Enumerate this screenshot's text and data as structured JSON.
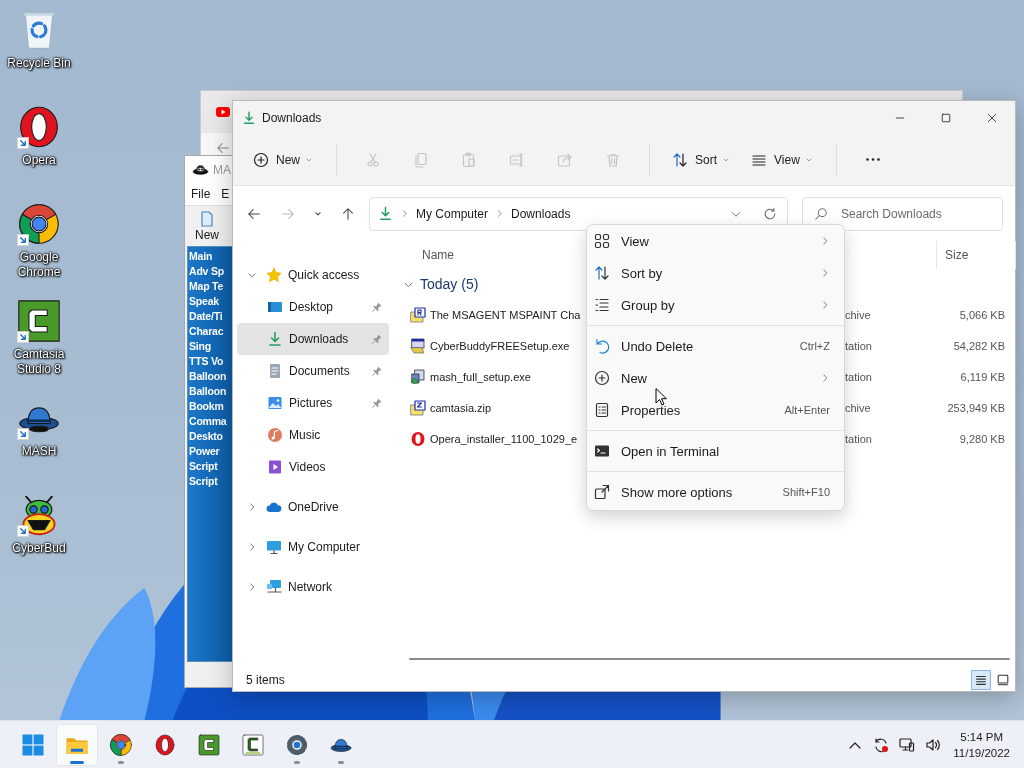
{
  "desktop_icons": [
    {
      "kind": "recycle-bin",
      "label": "Recycle Bin",
      "shortcut": false
    },
    {
      "kind": "opera",
      "label": "Opera",
      "shortcut": true
    },
    {
      "kind": "chrome",
      "label": "Google Chrome",
      "shortcut": true
    },
    {
      "kind": "camtasia",
      "label": "Camtasia Studio 8",
      "shortcut": true
    },
    {
      "kind": "mash",
      "label": "MASH",
      "shortcut": true
    },
    {
      "kind": "cyberbuddy",
      "label": "CyberBud",
      "shortcut": true
    }
  ],
  "mash_window": {
    "title": "MA",
    "menu": [
      "File",
      "E"
    ],
    "toolbar": [
      {
        "kind": "new",
        "label": "New"
      }
    ],
    "list": [
      "Main",
      "Adv Sp",
      "Map Te",
      "Speak",
      "Date/Ti",
      "Charac",
      "Sing",
      "TTS Vo",
      "Balloon",
      "Balloon",
      "Bookm",
      "Comma",
      "Deskto",
      "Power",
      "Script",
      "Script"
    ]
  },
  "explorer": {
    "title": "Downloads",
    "toolbar": [
      {
        "kind": "new",
        "label": "New",
        "dropdown": true,
        "disabled": false
      },
      {
        "kind": "separator"
      },
      {
        "kind": "cut",
        "disabled": true
      },
      {
        "kind": "copy",
        "disabled": true
      },
      {
        "kind": "paste",
        "disabled": true
      },
      {
        "kind": "rename",
        "disabled": true
      },
      {
        "kind": "share",
        "disabled": true
      },
      {
        "kind": "delete",
        "disabled": true
      },
      {
        "kind": "separator"
      },
      {
        "kind": "sort",
        "label": "Sort",
        "dropdown": true,
        "disabled": false
      },
      {
        "kind": "view",
        "label": "View",
        "dropdown": true,
        "disabled": false
      },
      {
        "kind": "separator"
      },
      {
        "kind": "more",
        "disabled": false
      }
    ],
    "navigation": [
      {
        "kind": "back",
        "disabled": false
      },
      {
        "kind": "forward",
        "disabled": true
      },
      {
        "kind": "recent",
        "disabled": false
      },
      {
        "kind": "up",
        "disabled": false
      }
    ],
    "breadcrumb": [
      "My Computer",
      "Downloads"
    ],
    "search": {
      "placeholder": "Search Downloads"
    },
    "nav_pane": [
      {
        "kind": "quick-access",
        "label": "Quick access",
        "expanded": true,
        "selected": false,
        "children": [
          {
            "kind": "desktop",
            "label": "Desktop",
            "pinned": true,
            "selected": false
          },
          {
            "kind": "downloads",
            "label": "Downloads",
            "pinned": true,
            "selected": true
          },
          {
            "kind": "documents",
            "label": "Documents",
            "pinned": true,
            "selected": false
          },
          {
            "kind": "pictures",
            "label": "Pictures",
            "pinned": true,
            "selected": false
          },
          {
            "kind": "music",
            "label": "Music",
            "pinned": false,
            "selected": false
          },
          {
            "kind": "videos",
            "label": "Videos",
            "pinned": false,
            "selected": false
          }
        ]
      },
      {
        "kind": "onedrive",
        "label": "OneDrive",
        "expanded": false,
        "selected": false
      },
      {
        "kind": "computer",
        "label": "My Computer",
        "expanded": false,
        "selected": false
      },
      {
        "kind": "network",
        "label": "Network",
        "expanded": false,
        "selected": false
      }
    ],
    "columns": {
      "name": "Name",
      "size": "Size"
    },
    "group": {
      "label": "Today (5)",
      "expanded": true
    },
    "files": [
      {
        "kind": "package",
        "name": "The MSAGENT MSPAINT Cha",
        "column_2": "chive",
        "size": "5,066 KB"
      },
      {
        "kind": "installer",
        "name": "CyberBuddyFREESetup.exe",
        "column_2": "tation",
        "size": "54,282 KB"
      },
      {
        "kind": "setup",
        "name": "mash_full_setup.exe",
        "column_2": "tation",
        "size": "6,119 KB"
      },
      {
        "kind": "archive",
        "name": "camtasia.zip",
        "column_2": "chive",
        "size": "253,949 KB"
      },
      {
        "kind": "opera",
        "name": "Opera_installer_1100_1029_e",
        "column_2": "tation",
        "size": "9,280 KB"
      }
    ],
    "status": "5 items",
    "view_modes": [
      {
        "kind": "details",
        "selected": true
      },
      {
        "kind": "tiles",
        "selected": false
      }
    ]
  },
  "context_menu": [
    {
      "kind": "view",
      "label": "View",
      "submenu": true
    },
    {
      "kind": "sort",
      "label": "Sort by",
      "submenu": true
    },
    {
      "kind": "group",
      "label": "Group by",
      "submenu": true
    },
    {
      "kind": "separator"
    },
    {
      "kind": "undo",
      "label": "Undo Delete",
      "shortcut": "Ctrl+Z",
      "submenu": false
    },
    {
      "kind": "new",
      "label": "New",
      "submenu": true
    },
    {
      "kind": "properties",
      "label": "Properties",
      "shortcut": "Alt+Enter",
      "submenu": false
    },
    {
      "kind": "separator"
    },
    {
      "kind": "terminal",
      "label": "Open in Terminal",
      "submenu": false
    },
    {
      "kind": "separator"
    },
    {
      "kind": "more-options",
      "label": "Show more options",
      "shortcut": "Shift+F10",
      "submenu": false
    }
  ],
  "taskbar": {
    "apps": [
      {
        "kind": "start",
        "running": false,
        "active": false
      },
      {
        "kind": "explorer",
        "running": true,
        "active": true
      },
      {
        "kind": "chrome",
        "running": true,
        "active": false
      },
      {
        "kind": "opera",
        "running": false,
        "active": false
      },
      {
        "kind": "camtasia",
        "running": false,
        "active": false
      },
      {
        "kind": "camtasia-recorder",
        "running": false,
        "active": false
      },
      {
        "kind": "settings",
        "running": true,
        "active": false
      },
      {
        "kind": "mash",
        "running": true,
        "active": false
      }
    ],
    "tray": [
      {
        "kind": "chevron"
      },
      {
        "kind": "sync"
      },
      {
        "kind": "network"
      },
      {
        "kind": "volume"
      }
    ],
    "clock": {
      "time": "5:14 PM",
      "date": "11/19/2022"
    }
  }
}
